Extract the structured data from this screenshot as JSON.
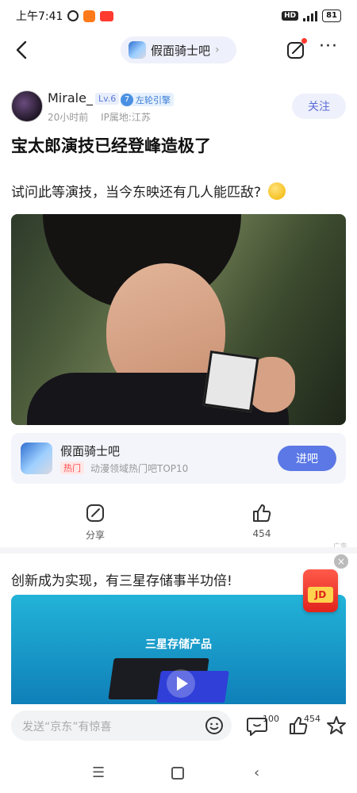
{
  "status_bar": {
    "time": "上午7:41",
    "hd": "HD",
    "battery": "81"
  },
  "nav": {
    "forum_name": "假面骑士吧"
  },
  "post": {
    "author": {
      "name": "Mirale_",
      "level": "Lv.6",
      "badge_num": "7",
      "badge_text": "左轮引擎",
      "time": "20小时前",
      "ip": "IP属地:江苏",
      "follow_label": "关注"
    },
    "title": "宝太郎演技已经登峰造极了",
    "body": "试问此等演技，当今东映还有几人能匹敌?"
  },
  "forum_card": {
    "name": "假面骑士吧",
    "hot_tag": "热门",
    "desc": "动漫领域热门吧TOP10",
    "join_label": "进吧"
  },
  "actions": {
    "share_label": "分享",
    "like_count": "454"
  },
  "ad": {
    "tag": "广告",
    "title": "创新成为实现，有三星存储事半功倍!",
    "product": "三星存储产品",
    "brand_badge": "JD"
  },
  "comment_bar": {
    "placeholder": "发送“京东”有惊喜",
    "comment_count": "100",
    "like_count": "454"
  },
  "colors": {
    "accent": "#5b78e6",
    "follow_text": "#5a6cd8",
    "hot": "#ff4d4f"
  },
  "icons": [
    "back-icon",
    "edit-icon",
    "more-icon",
    "share-icon",
    "like-icon",
    "emoji-icon",
    "comment-icon",
    "star-icon",
    "close-icon",
    "play-icon"
  ]
}
